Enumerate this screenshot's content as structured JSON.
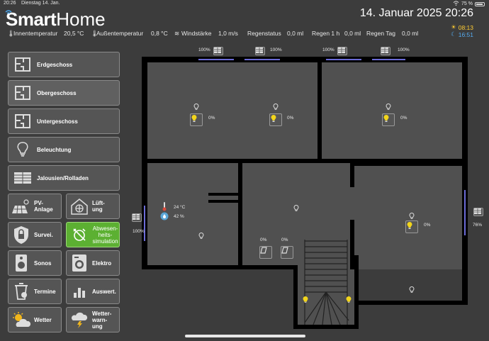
{
  "statusbar": {
    "time": "20:26",
    "date": "Dienstag 14. Jan.",
    "battery": "75 %"
  },
  "header": {
    "logo_bold": "Smart",
    "logo_light": "Home",
    "datetime": "14. Januar 2025  20:26",
    "sunrise": "08:13",
    "sunset": "16:51",
    "sun_color": "#ffcc33",
    "moon_color": "#55aaee"
  },
  "measures": {
    "inside_label": "Innentemperatur",
    "inside_value": "20,5 °C",
    "outside_label": "Außentemperatur",
    "outside_value": "0,8 °C",
    "wind_label": "Windstärke",
    "wind_value": "1,0 m/s",
    "rain_status_label": "Regenstatus",
    "rain_status_value": "0,0 ml",
    "rain_hour_label": "Regen 1 h",
    "rain_hour_value": "0,0 ml",
    "rain_day_label": "Regen Tag",
    "rain_day_value": "0,0 ml"
  },
  "nav": {
    "floors": [
      {
        "label": "Erdgeschoss",
        "icon": "floorplan-icon"
      },
      {
        "label": "Obergeschoss",
        "icon": "floorplan-icon"
      },
      {
        "label": "Untergeschoss",
        "icon": "floorplan-icon"
      },
      {
        "label": "Beleuchtung",
        "icon": "lightbulb-icon"
      },
      {
        "label": "Jalousien/Rolladen",
        "icon": "window-blind-icon"
      }
    ],
    "pv": "PV-\nAnlage",
    "ventilation": "Lüft-\nung",
    "surveillance": "Survei.",
    "absence": "Abwesen-\nheits-\nsimulation",
    "sonos": "Sonos",
    "elektro": "Elektro",
    "termine": "Termine",
    "auswert": "Auswert.",
    "wetter": "Wetter",
    "wetterwarnung": "Wetter-\nwarn-\nung",
    "accent_green": "#5cb032"
  },
  "plan": {
    "blinds": [
      {
        "name": "blind-top-1",
        "value": "100%"
      },
      {
        "name": "blind-top-2",
        "value": "100%"
      },
      {
        "name": "blind-top-3",
        "value": "100%"
      },
      {
        "name": "blind-top-4",
        "value": "100%"
      },
      {
        "name": "blind-left",
        "value": "100%"
      },
      {
        "name": "blind-right",
        "value": "76%"
      }
    ],
    "lamps": [
      {
        "name": "lamp-room-1",
        "value": "0%"
      },
      {
        "name": "lamp-room-2",
        "value": "0%"
      },
      {
        "name": "lamp-room-3",
        "value": "0%"
      },
      {
        "name": "lamp-room-4",
        "value": "0%"
      }
    ],
    "windows_tilt": [
      {
        "name": "window-tilt-1",
        "value": "0%"
      },
      {
        "name": "window-tilt-2",
        "value": "0%"
      }
    ],
    "climate": {
      "temperature": "24 °C",
      "humidity": "42 %"
    }
  }
}
